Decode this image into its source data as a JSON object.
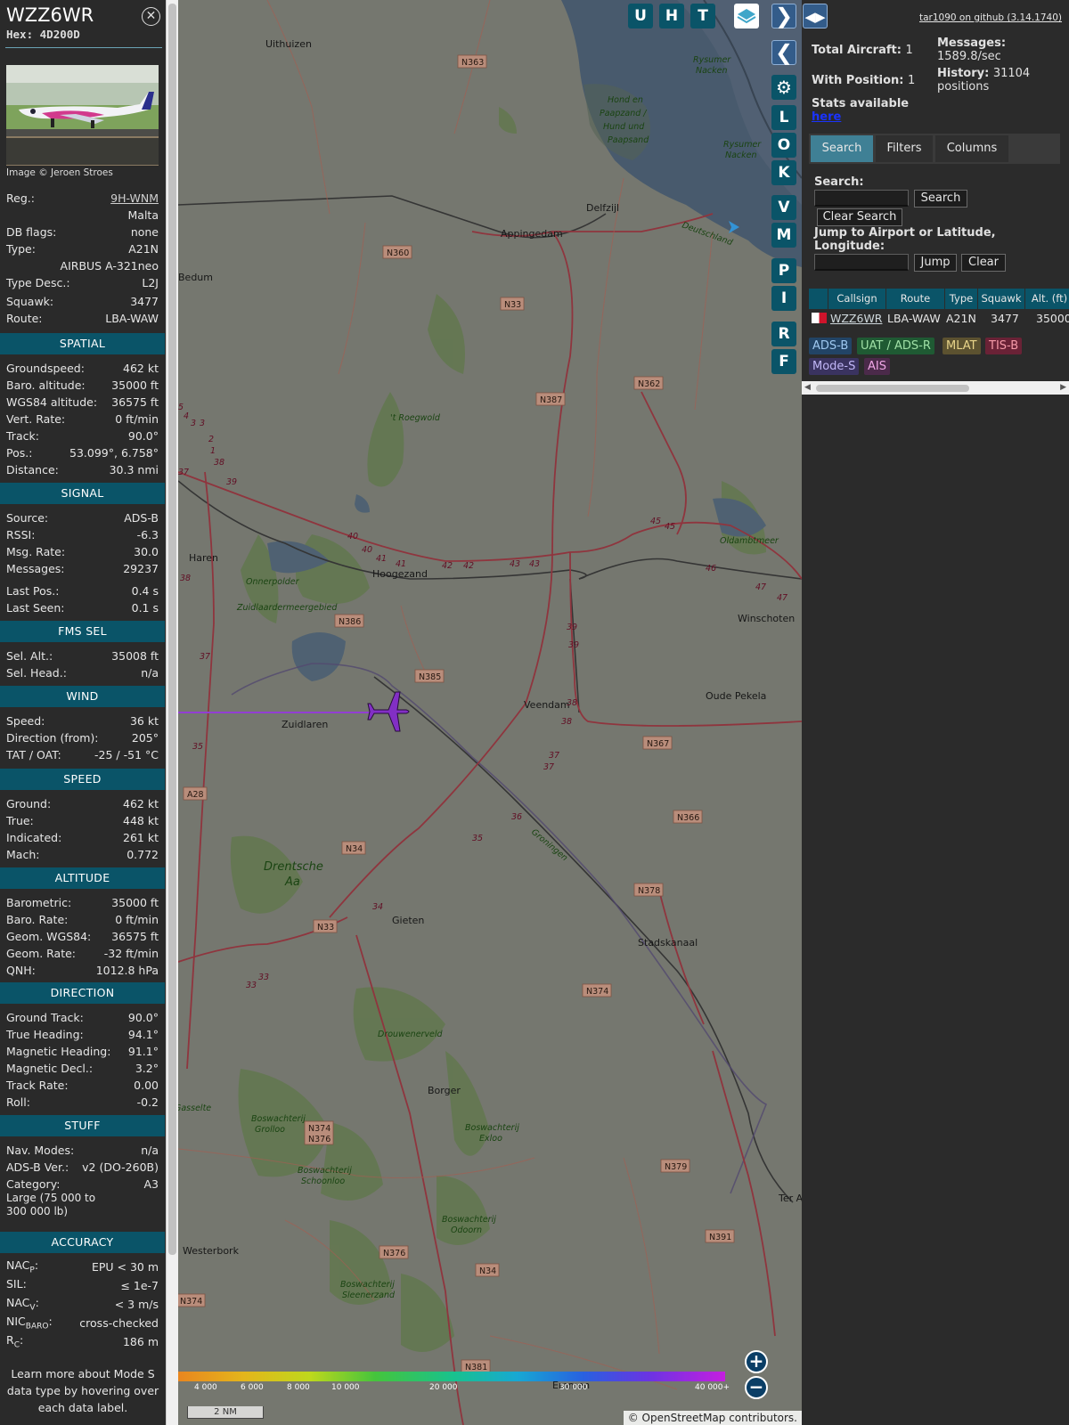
{
  "aircraft": {
    "callsign": "WZZ6WR",
    "hex_label": "Hex:",
    "hex": "4D200D",
    "image_credit": "Image © Jeroen Stroes"
  },
  "info_rows": [
    {
      "label": "Reg.:",
      "value": "9H-WNM",
      "link": true
    },
    {
      "label": "",
      "value": "Malta"
    },
    {
      "label": "DB flags:",
      "value": "none"
    },
    {
      "label": "Type:",
      "value": "A21N"
    },
    {
      "label": "",
      "value": "AIRBUS A-321neo"
    },
    {
      "label": "Type Desc.:",
      "value": "L2J"
    },
    {
      "label": "Squawk:",
      "value": "3477"
    },
    {
      "label": "Route:",
      "value": "LBA-WAW"
    }
  ],
  "sections": {
    "spatial": {
      "title": "SPATIAL",
      "rows": [
        {
          "label": "Groundspeed:",
          "value": "462 kt"
        },
        {
          "label": "Baro. altitude:",
          "value": "35000 ft"
        },
        {
          "label": "WGS84 altitude:",
          "value": "36575 ft"
        },
        {
          "label": "Vert. Rate:",
          "value": "0 ft/min"
        },
        {
          "label": "Track:",
          "value": "90.0°"
        },
        {
          "label": "Pos.:",
          "value": "53.099°, 6.758°"
        },
        {
          "label": "Distance:",
          "value": "30.3 nmi"
        }
      ]
    },
    "signal": {
      "title": "SIGNAL",
      "rows": [
        {
          "label": "Source:",
          "value": "ADS-B"
        },
        {
          "label": "RSSI:",
          "value": "-6.3"
        },
        {
          "label": "Msg. Rate:",
          "value": "30.0"
        },
        {
          "label": "Messages:",
          "value": "29237"
        },
        {
          "label": "Last Pos.:",
          "value": "0.4 s"
        },
        {
          "label": "Last Seen:",
          "value": "0.1 s"
        }
      ]
    },
    "fms": {
      "title": "FMS SEL",
      "rows": [
        {
          "label": "Sel. Alt.:",
          "value": "35008 ft"
        },
        {
          "label": "Sel. Head.:",
          "value": "n/a"
        }
      ]
    },
    "wind": {
      "title": "WIND",
      "rows": [
        {
          "label": "Speed:",
          "value": "36 kt"
        },
        {
          "label": "Direction (from):",
          "value": "205°"
        },
        {
          "label": "TAT / OAT:",
          "value": "-25 / -51 °C"
        }
      ]
    },
    "speed": {
      "title": "SPEED",
      "rows": [
        {
          "label": "Ground:",
          "value": "462 kt"
        },
        {
          "label": "True:",
          "value": "448 kt"
        },
        {
          "label": "Indicated:",
          "value": "261 kt"
        },
        {
          "label": "Mach:",
          "value": "0.772"
        }
      ]
    },
    "altitude": {
      "title": "ALTITUDE",
      "rows": [
        {
          "label": "Barometric:",
          "value": "35000 ft"
        },
        {
          "label": "Baro. Rate:",
          "value": "0 ft/min"
        },
        {
          "label": "Geom. WGS84:",
          "value": "36575 ft"
        },
        {
          "label": "Geom. Rate:",
          "value": "-32 ft/min"
        },
        {
          "label": "QNH:",
          "value": "1012.8 hPa"
        }
      ]
    },
    "direction": {
      "title": "DIRECTION",
      "rows": [
        {
          "label": "Ground Track:",
          "value": "90.0°"
        },
        {
          "label": "True Heading:",
          "value": "94.1°"
        },
        {
          "label": "Magnetic Heading:",
          "value": "91.1°"
        },
        {
          "label": "Magnetic Decl.:",
          "value": "3.2°"
        },
        {
          "label": "Track Rate:",
          "value": "0.00"
        },
        {
          "label": "Roll:",
          "value": "-0.2"
        }
      ]
    },
    "stuff": {
      "title": "STUFF",
      "rows": [
        {
          "label": "Nav. Modes:",
          "value": "n/a"
        },
        {
          "label": "ADS-B Ver.:",
          "value": "v2 (DO-260B)"
        },
        {
          "label": "Category:",
          "value": "A3"
        }
      ],
      "category_desc_1": "Large (75 000 to",
      "category_desc_2": "300 000 lb)"
    },
    "accuracy": {
      "title": "ACCURACY",
      "rows": [
        {
          "label": "NAC",
          "sub": "P",
          "suffix": ":",
          "value": "EPU < 30 m"
        },
        {
          "label": "SIL:",
          "sub": "",
          "suffix": "",
          "value": "≤ 1e-7"
        },
        {
          "label": "NAC",
          "sub": "V",
          "suffix": ":",
          "value": "< 3 m/s"
        },
        {
          "label": "NIC",
          "sub": "BARO",
          "suffix": ":",
          "value": "cross-checked"
        },
        {
          "label": "R",
          "sub": "C",
          "suffix": ":",
          "value": "186 m"
        }
      ]
    }
  },
  "help_note": [
    "Learn more about Mode S",
    "data type by hovering over",
    "each data label."
  ],
  "map": {
    "buttons": [
      "U",
      "H",
      "T"
    ],
    "side_buttons": [
      "L",
      "O",
      "K",
      "V",
      "M",
      "P",
      "I",
      "R",
      "F"
    ],
    "attribution": "© OpenStreetMap contributors.",
    "scale": "2 NM",
    "color_scale": [
      "4 000",
      "6 000",
      "8 000",
      "10 000",
      "20 000",
      "30 000",
      "40 000+"
    ],
    "zoom_in": "+",
    "zoom_out": "−",
    "towns": [
      "Uithuizen",
      "Delfzijl",
      "Appingedam",
      "Bedum",
      "Haren",
      "Hoogezand",
      "Winschoten",
      "Zuidlaren",
      "Veendam",
      "Oude Pekela",
      "Gieten",
      "Stadskanaal",
      "Borger",
      "Westerbork",
      "Emmen",
      "Ter Ap"
    ],
    "nature": [
      "Hond en",
      "Paapzand /",
      "Hund und",
      "Paapsand",
      "Rysumer",
      "Nacken",
      "Deutschland",
      "'t Roegwold",
      "Onnerpolder",
      "Zuidlaardermeergebied",
      "Oldambtmeer",
      "Drentsche",
      "Aa",
      "Drouwenerveld",
      "Boswachterij",
      "Grolloo",
      "Exloo",
      "Schoonloo",
      "Odoorn",
      "Sleenerzand",
      "Gasselte",
      "Groningen"
    ],
    "roads": [
      "N363",
      "N360",
      "N33",
      "N362",
      "N387",
      "N386",
      "N385",
      "N367",
      "A28",
      "N34",
      "N366",
      "N378",
      "N33",
      "N374",
      "N379",
      "N374",
      "N376",
      "N376",
      "N34",
      "N391",
      "N374",
      "N381"
    ]
  },
  "stats": {
    "total_label": "Total Aircraft:",
    "total": "1",
    "pos_label": "With Position:",
    "pos": "1",
    "msgs_label": "Messages:",
    "msgs": "1589.8/sec",
    "hist_label": "History:",
    "hist": "31104",
    "hist_unit": "positions",
    "stats_label": "Stats available",
    "stats_link": "here",
    "github": "tar1090 on github (3.14.1740)"
  },
  "tabs": [
    "Search",
    "Filters",
    "Columns"
  ],
  "search": {
    "search_label": "Search:",
    "search_btn": "Search",
    "clear_search_btn": "Clear Search",
    "jump_label_1": "Jump to Airport or Latitude,",
    "jump_label_2": "Longitude:",
    "jump_btn": "Jump",
    "clear_btn": "Clear"
  },
  "table": {
    "headers": [
      "Callsign",
      "Route",
      "Type",
      "Squawk",
      "Alt. (ft)"
    ],
    "row": {
      "callsign": "WZZ6WR",
      "route": "LBA-WAW",
      "type": "A21N",
      "squawk": "3477",
      "alt": "35000"
    }
  },
  "legend": [
    {
      "label": "ADS-B",
      "color": "#224466"
    },
    {
      "label": "UAT / ADS-R",
      "color": "#1f5a33"
    },
    {
      "label": "MLAT",
      "color": "#5c5230"
    },
    {
      "label": "TIS-B",
      "color": "#6a2236"
    },
    {
      "label": "Mode-S",
      "color": "#3a3360"
    },
    {
      "label": "AIS",
      "color": "#4b2a4a"
    }
  ]
}
